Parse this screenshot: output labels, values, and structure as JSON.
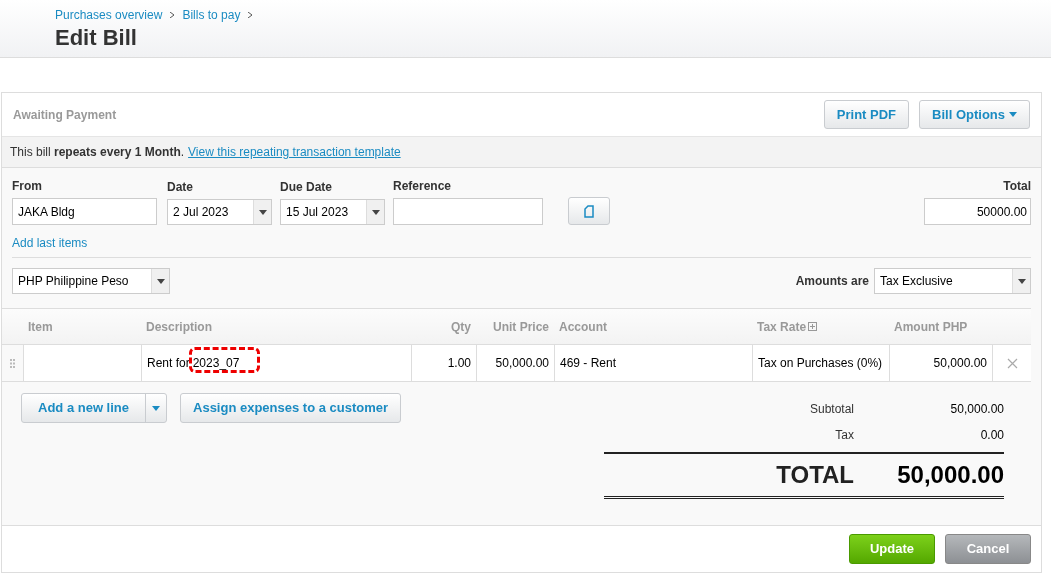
{
  "breadcrumbs": [
    "Purchases overview",
    "Bills to pay"
  ],
  "title": "Edit Bill",
  "status": "Awaiting Payment",
  "header_buttons": [
    {
      "label": "Print PDF",
      "kind": "plain"
    },
    {
      "label": "Bill Options",
      "kind": "menu"
    }
  ],
  "notice": {
    "text": "This bill **repeats every 1 Month**.",
    "link": "View this repeating transaction template"
  },
  "fields": [
    {
      "label": "From",
      "value": "JAKA Bldg",
      "kind": "text"
    },
    {
      "label": "Date",
      "value": "2 Jul 2023",
      "kind": "date"
    },
    {
      "label": "Due Date",
      "value": "15 Jul 2023",
      "kind": "date"
    },
    {
      "label": "Reference",
      "kind": "text"
    }
  ],
  "total_field": {
    "label": "Total",
    "value": "50000.00"
  },
  "add_last_items": "Add last items",
  "currency": "PHP Philippine Peso",
  "amounts_are": {
    "label": "Amounts are",
    "value": "Tax Exclusive"
  },
  "table": {
    "columns": [
      "Item",
      "Description",
      "Qty",
      "Unit Price",
      "Account",
      "Tax Rate",
      "Amount PHP"
    ],
    "rows": [
      {
        "description_prefix": "Rent for",
        "description_highlighted": "2023_07",
        "qty": "1.00",
        "unit_price": "50,000.00",
        "account": "469 - Rent",
        "tax_rate": "Tax on Purchases (0%)",
        "amount": "50,000.00"
      }
    ]
  },
  "line_buttons": [
    "Add a new line",
    "Assign expenses to a customer"
  ],
  "summary": [
    {
      "label": "Subtotal",
      "value": "50,000.00"
    },
    {
      "label": "Tax",
      "value": "0.00"
    }
  ],
  "grand_total": {
    "label": "TOTAL",
    "value": "50,000.00"
  },
  "footer_buttons": [
    {
      "label": "Update",
      "kind": "primary"
    },
    {
      "label": "Cancel",
      "kind": "secondary"
    }
  ]
}
